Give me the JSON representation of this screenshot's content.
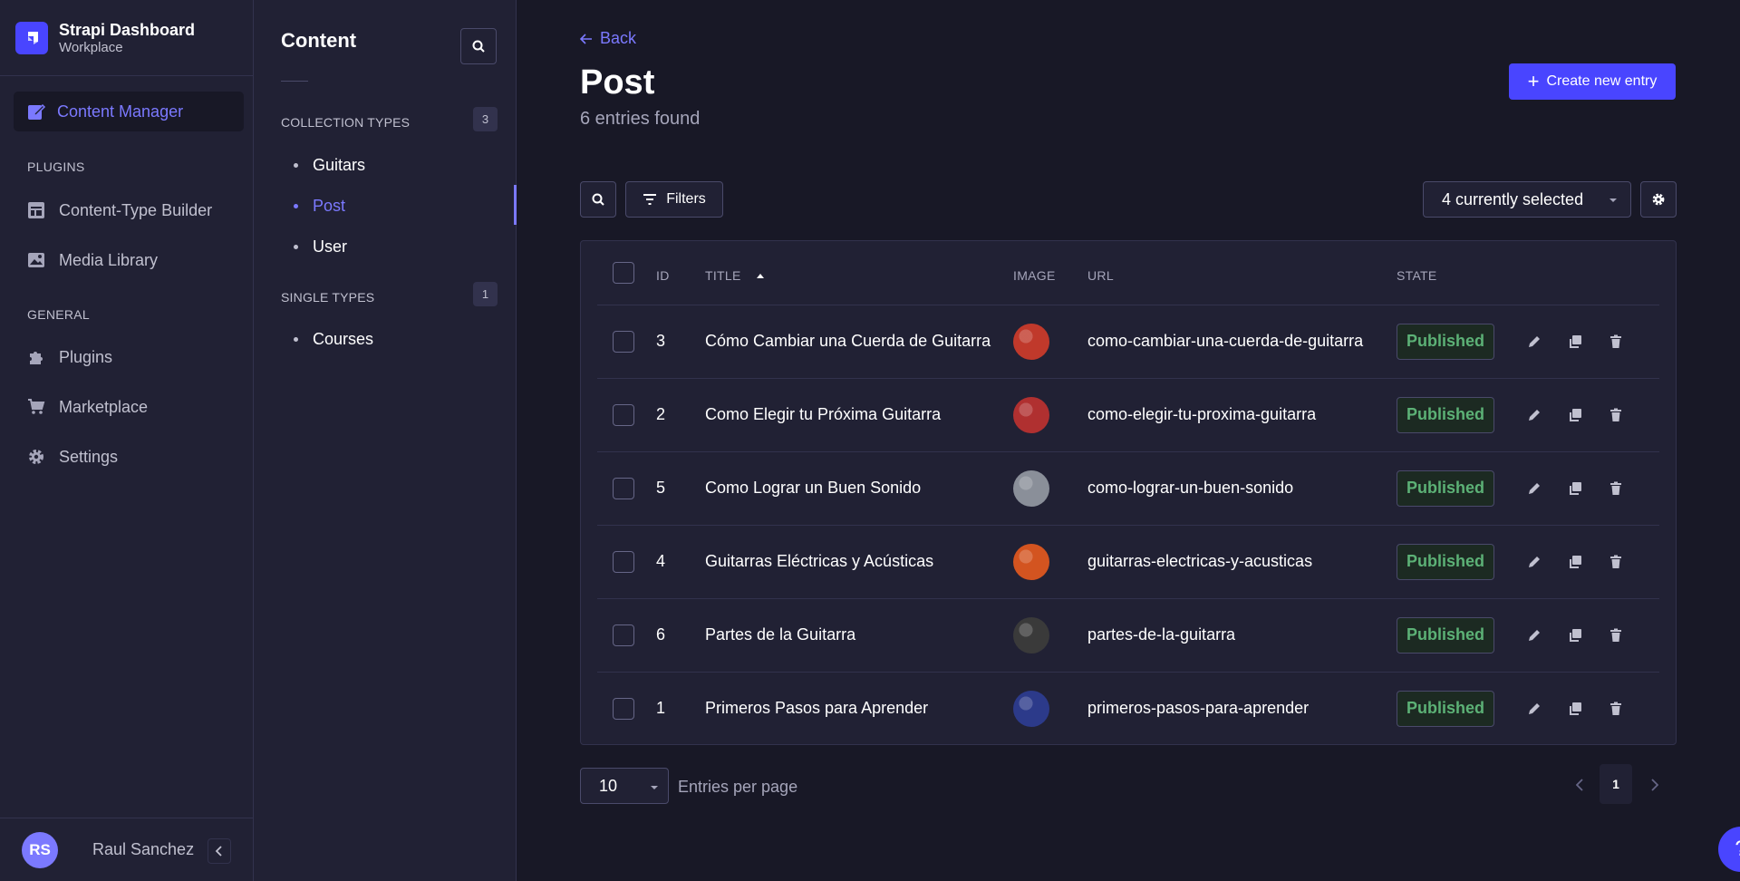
{
  "brand": {
    "title": "Strapi Dashboard",
    "subtitle": "Workplace"
  },
  "nav": {
    "active": {
      "label": "Content Manager",
      "icon": "content-manager-icon"
    },
    "plugins_heading": "PLUGINS",
    "plugins": [
      {
        "label": "Content-Type Builder",
        "icon": "layout-icon"
      },
      {
        "label": "Media Library",
        "icon": "image-icon"
      }
    ],
    "general_heading": "GENERAL",
    "general": [
      {
        "label": "Plugins",
        "icon": "puzzle-icon"
      },
      {
        "label": "Marketplace",
        "icon": "cart-icon"
      },
      {
        "label": "Settings",
        "icon": "gear-icon"
      }
    ],
    "user": {
      "initials": "RS",
      "name": "Raul Sanchez"
    }
  },
  "subnav": {
    "title": "Content",
    "collection_heading": "COLLECTION TYPES",
    "collection_count": "3",
    "collection_items": [
      "Guitars",
      "Post",
      "User"
    ],
    "single_heading": "SINGLE TYPES",
    "single_count": "1",
    "single_items": [
      "Courses"
    ]
  },
  "main": {
    "back_label": "Back",
    "title": "Post",
    "subtitle": "6 entries found",
    "create_label": "Create new entry",
    "filters_label": "Filters",
    "columns_select": "4 currently selected",
    "table": {
      "headers": {
        "id": "ID",
        "title": "TITLE",
        "image": "IMAGE",
        "url": "URL",
        "state": "STATE"
      },
      "rows": [
        {
          "id": "3",
          "title": "Cómo Cambiar una Cuerda de Guitarra",
          "url": "como-cambiar-una-cuerda-de-guitarra",
          "state": "Published",
          "thumb": "#c0392b"
        },
        {
          "id": "2",
          "title": "Como Elegir tu Próxima Guitarra",
          "url": "como-elegir-tu-proxima-guitarra",
          "state": "Published",
          "thumb": "#b03030"
        },
        {
          "id": "5",
          "title": "Como Lograr un Buen Sonido",
          "url": "como-lograr-un-buen-sonido",
          "state": "Published",
          "thumb": "#8a8f99"
        },
        {
          "id": "4",
          "title": "Guitarras Eléctricas y Acústicas",
          "url": "guitarras-electricas-y-acusticas",
          "state": "Published",
          "thumb": "#d35420"
        },
        {
          "id": "6",
          "title": "Partes de la Guitarra",
          "url": "partes-de-la-guitarra",
          "state": "Published",
          "thumb": "#3a3a3a"
        },
        {
          "id": "1",
          "title": "Primeros Pasos para Aprender",
          "url": "primeros-pasos-para-aprender",
          "state": "Published",
          "thumb": "#2c3a8a"
        }
      ]
    },
    "per_page_value": "10",
    "per_page_label": "Entries per page",
    "current_page": "1",
    "help_label": "?"
  },
  "colors": {
    "accent": "#4945ff",
    "accent_text": "#7b79ff",
    "published": "#5cb176",
    "surface": "#212134",
    "background": "#181826"
  }
}
